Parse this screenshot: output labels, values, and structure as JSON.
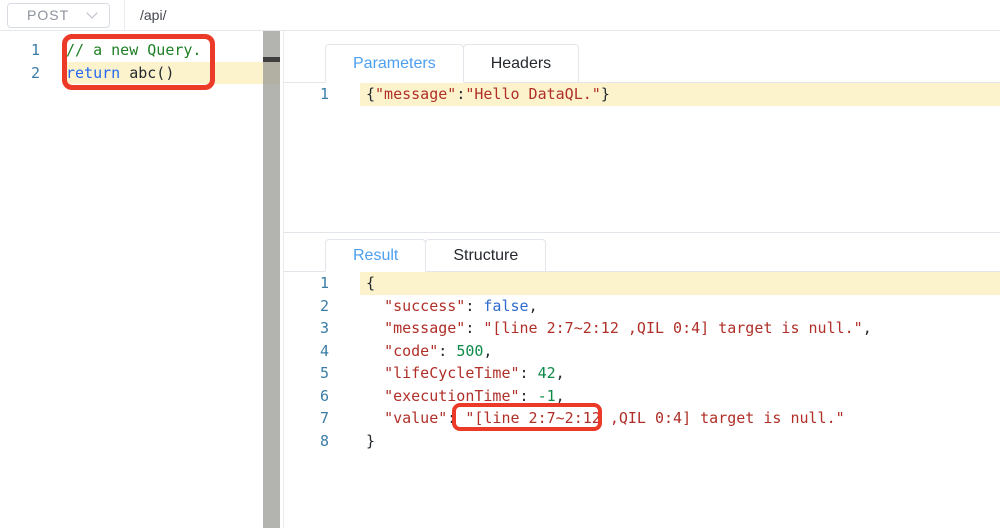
{
  "topbar": {
    "method": "POST",
    "url": "/api/"
  },
  "colors": {
    "tab_active": "#4c9ff0",
    "annotation_red": "#ec3a28",
    "line_highlight": "#fcf3cd",
    "gutter_blue": "#3a7ca5",
    "comment_green": "#1d7f24",
    "keyword_blue": "#2468f2",
    "string_red": "#b02f28",
    "number_green": "#0e8a48",
    "bool_blue": "#2f6bce"
  },
  "editor": {
    "lines": [
      {
        "num": "1",
        "tokens": [
          {
            "c": "comment",
            "t": "// a new Query."
          }
        ]
      },
      {
        "num": "2",
        "highlight": true,
        "tokens": [
          {
            "c": "keyword",
            "t": "return"
          },
          {
            "c": "plain",
            "t": " abc()"
          }
        ]
      }
    ]
  },
  "request_panel": {
    "tabs": [
      {
        "label": "Parameters",
        "active": true
      },
      {
        "label": "Headers",
        "active": false
      }
    ],
    "lines": [
      {
        "num": "1",
        "highlight": true,
        "tokens": [
          {
            "c": "plain",
            "t": "{"
          },
          {
            "c": "string",
            "t": "\"message\""
          },
          {
            "c": "plain",
            "t": ":"
          },
          {
            "c": "string",
            "t": "\"Hello DataQL.\""
          },
          {
            "c": "plain",
            "t": "}"
          }
        ]
      }
    ]
  },
  "response_panel": {
    "tabs": [
      {
        "label": "Result",
        "active": true
      },
      {
        "label": "Structure",
        "active": false
      }
    ],
    "lines": [
      {
        "num": "1",
        "highlight": true,
        "tokens": [
          {
            "c": "plain",
            "t": "{"
          }
        ]
      },
      {
        "num": "2",
        "tokens": [
          {
            "c": "plain",
            "t": "  "
          },
          {
            "c": "string",
            "t": "\"success\""
          },
          {
            "c": "plain",
            "t": ": "
          },
          {
            "c": "bool",
            "t": "false"
          },
          {
            "c": "plain",
            "t": ","
          }
        ]
      },
      {
        "num": "3",
        "tokens": [
          {
            "c": "plain",
            "t": "  "
          },
          {
            "c": "string",
            "t": "\"message\""
          },
          {
            "c": "plain",
            "t": ": "
          },
          {
            "c": "string",
            "t": "\"[line 2:7~2:12 ,QIL 0:4] target is null.\""
          },
          {
            "c": "plain",
            "t": ","
          }
        ]
      },
      {
        "num": "4",
        "tokens": [
          {
            "c": "plain",
            "t": "  "
          },
          {
            "c": "string",
            "t": "\"code\""
          },
          {
            "c": "plain",
            "t": ": "
          },
          {
            "c": "number",
            "t": "500"
          },
          {
            "c": "plain",
            "t": ","
          }
        ]
      },
      {
        "num": "5",
        "tokens": [
          {
            "c": "plain",
            "t": "  "
          },
          {
            "c": "string",
            "t": "\"lifeCycleTime\""
          },
          {
            "c": "plain",
            "t": ": "
          },
          {
            "c": "number",
            "t": "42"
          },
          {
            "c": "plain",
            "t": ","
          }
        ]
      },
      {
        "num": "6",
        "tokens": [
          {
            "c": "plain",
            "t": "  "
          },
          {
            "c": "string",
            "t": "\"executionTime\""
          },
          {
            "c": "plain",
            "t": ": "
          },
          {
            "c": "number",
            "t": "-1"
          },
          {
            "c": "plain",
            "t": ","
          }
        ]
      },
      {
        "num": "7",
        "tokens": [
          {
            "c": "plain",
            "t": "  "
          },
          {
            "c": "string",
            "t": "\"value\""
          },
          {
            "c": "plain",
            "t": ": "
          },
          {
            "c": "string",
            "t": "\"[line 2:7~2:12 ,QIL 0:4] target is null.\""
          }
        ]
      },
      {
        "num": "8",
        "tokens": [
          {
            "c": "plain",
            "t": "}"
          }
        ]
      }
    ]
  }
}
